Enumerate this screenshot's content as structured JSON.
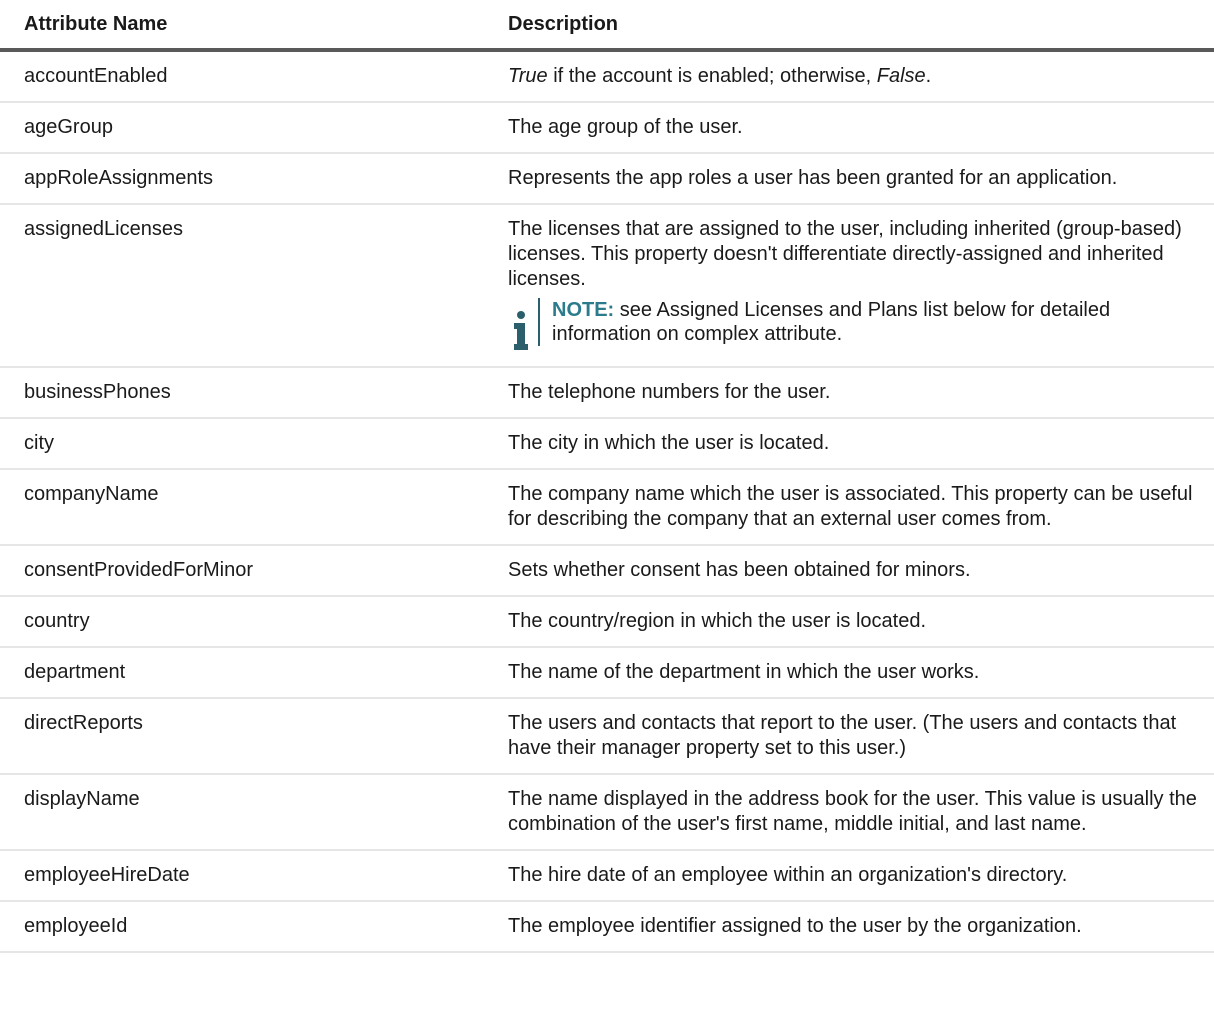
{
  "table": {
    "headers": [
      "Attribute Name",
      "Description"
    ],
    "rows": [
      {
        "name": "accountEnabled",
        "desc_segments": [
          {
            "text": "True",
            "italic": true
          },
          {
            "text": " if the account is enabled; otherwise, ",
            "italic": false
          },
          {
            "text": "False",
            "italic": true
          },
          {
            "text": ".",
            "italic": false
          }
        ]
      },
      {
        "name": "ageGroup",
        "desc": "The age group of the user."
      },
      {
        "name": "appRoleAssignments",
        "desc": "Represents the app roles a user has been granted for an application."
      },
      {
        "name": "assignedLicenses",
        "desc": "The licenses that are assigned to the user, including inherited (group-based) licenses. This property doesn't differentiate directly-assigned and inherited licenses.",
        "note": {
          "icon": "info-icon",
          "label": "NOTE:",
          "text": " see Assigned Licenses and Plans list below for detailed information on complex attribute."
        }
      },
      {
        "name": "businessPhones",
        "desc": "The telephone numbers for the user."
      },
      {
        "name": "city",
        "desc": "The city in which the user is located."
      },
      {
        "name": "companyName",
        "desc": "The company name which the user is associated. This property can be useful for describing the company that an external user comes from."
      },
      {
        "name": "consentProvidedForMinor",
        "desc": "Sets whether consent has been obtained for minors."
      },
      {
        "name": "country",
        "desc": "The country/region in which the user is located."
      },
      {
        "name": "department",
        "desc": "The name of the department in which the user works."
      },
      {
        "name": "directReports",
        "desc": "The users and contacts that report to the user. (The users and contacts that have their manager property set to this user.)"
      },
      {
        "name": "displayName",
        "desc": "The name displayed in the address book for the user. This value is usually the combination of the user's first name, middle initial, and last name."
      },
      {
        "name": "employeeHireDate",
        "desc": "The hire date of an employee within an organization's directory."
      },
      {
        "name": "employeeId",
        "desc": "The employee identifier assigned to the user by the organization."
      }
    ]
  },
  "colors": {
    "header_rule": "#595959",
    "row_rule": "#e6e6e6",
    "note_accent": "#2b7b8c",
    "text": "#1a1a1a"
  }
}
